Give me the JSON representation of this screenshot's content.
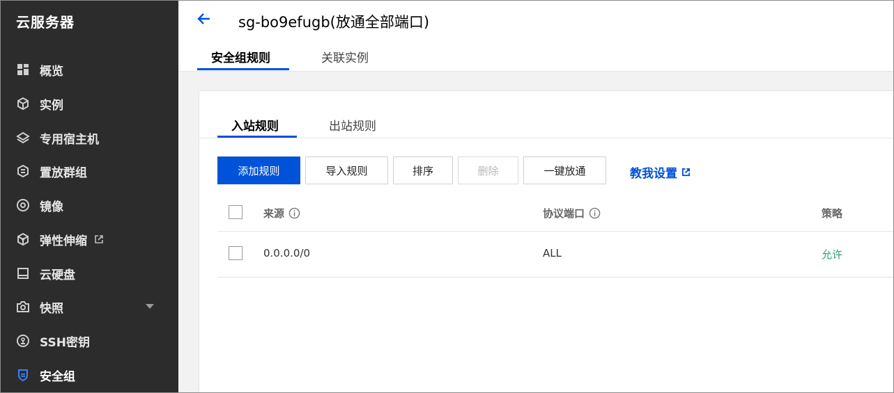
{
  "sidebar": {
    "title": "云服务器",
    "items": [
      {
        "label": "概览",
        "icon": "dashboard-icon"
      },
      {
        "label": "实例",
        "icon": "cube-icon"
      },
      {
        "label": "专用宿主机",
        "icon": "layers-icon"
      },
      {
        "label": "置放群组",
        "icon": "hexagon-group-icon"
      },
      {
        "label": "镜像",
        "icon": "disc-icon"
      },
      {
        "label": "弹性伸缩",
        "icon": "scaling-icon"
      },
      {
        "label": "云硬盘",
        "icon": "disk-icon"
      },
      {
        "label": "快照",
        "icon": "camera-icon"
      },
      {
        "label": "SSH密钥",
        "icon": "key-icon"
      },
      {
        "label": "安全组",
        "icon": "shield-icon"
      }
    ]
  },
  "header": {
    "title": "sg-bo9efugb(放通全部端口)",
    "tabs": [
      "安全组规则",
      "关联实例"
    ]
  },
  "rules": {
    "subtabs": [
      "入站规则",
      "出站规则"
    ],
    "buttons": {
      "add": "添加规则",
      "import": "导入规则",
      "sort": "排序",
      "delete": "删除",
      "allow_all": "一键放通"
    },
    "help_link": "教我设置",
    "columns": [
      "来源",
      "协议端口",
      "策略"
    ],
    "rows": [
      {
        "source": "0.0.0.0/0",
        "port": "ALL",
        "policy": "允许"
      }
    ]
  },
  "colors": {
    "accent": "#0052d9",
    "sidebar_bg": "#2c2c2c",
    "allow_green": "#2ba471"
  }
}
